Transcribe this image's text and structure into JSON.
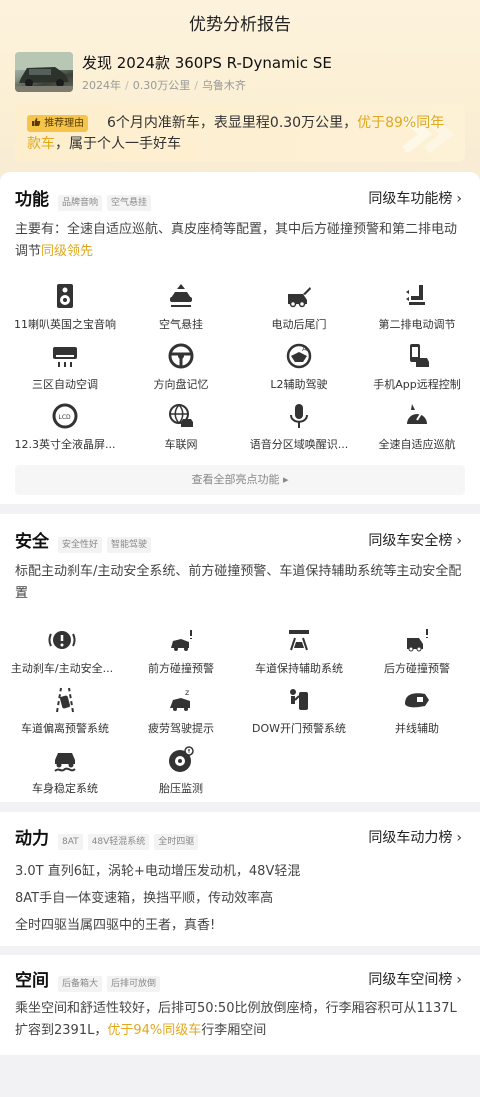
{
  "header": {
    "title": "优势分析报告"
  },
  "car": {
    "title": "发现 2024款 360PS R-Dynamic SE",
    "year": "2024年",
    "mileage": "0.30万公里",
    "city": "乌鲁木齐",
    "separator": "/"
  },
  "reason": {
    "tag": "推荐理由",
    "text_before": "6个月内准新车，表显里程0.30万公里，",
    "text_highlight": "优于89%同年款车",
    "text_after": "，属于个人一手好车"
  },
  "function": {
    "title": "功能",
    "chips": [
      "品牌音响",
      "空气悬挂"
    ],
    "rank_label": "同级车功能榜",
    "desc_before": "主要有：全速自适应巡航、真皮座椅等配置，其中后方碰撞预警和第二排电动调节",
    "desc_highlight": "同级领先",
    "items": [
      {
        "label": "11喇叭英国之宝音响",
        "icon": "speaker-icon"
      },
      {
        "label": "空气悬挂",
        "icon": "air-suspension-icon"
      },
      {
        "label": "电动后尾门",
        "icon": "power-tailgate-icon"
      },
      {
        "label": "第二排电动调节",
        "icon": "seat-adjust-icon"
      },
      {
        "label": "三区自动空调",
        "icon": "air-conditioner-icon"
      },
      {
        "label": "方向盘记忆",
        "icon": "steering-wheel-icon"
      },
      {
        "label": "L2辅助驾驶",
        "icon": "assisted-driving-icon"
      },
      {
        "label": "手机App远程控制",
        "icon": "phone-car-icon"
      },
      {
        "label": "12.3英寸全液晶屏...",
        "icon": "lcd-gauge-icon"
      },
      {
        "label": "车联网",
        "icon": "connected-car-icon"
      },
      {
        "label": "语音分区域唤醒识...",
        "icon": "microphone-icon"
      },
      {
        "label": "全速自适应巡航",
        "icon": "adaptive-cruise-icon"
      }
    ],
    "see_all": "查看全部亮点功能"
  },
  "safety": {
    "title": "安全",
    "chips": [
      "安全性好",
      "智能驾驶"
    ],
    "rank_label": "同级车安全榜",
    "desc": "标配主动刹车/主动安全系统、前方碰撞预警、车道保持辅助系统等主动安全配置",
    "items": [
      {
        "label": "主动刹车/主动安全...",
        "icon": "active-brake-icon"
      },
      {
        "label": "前方碰撞预警",
        "icon": "front-collision-icon"
      },
      {
        "label": "车道保持辅助系统",
        "icon": "lane-keep-icon"
      },
      {
        "label": "后方碰撞预警",
        "icon": "rear-collision-icon"
      },
      {
        "label": "车道偏离预警系统",
        "icon": "lane-departure-icon"
      },
      {
        "label": "疲劳驾驶提示",
        "icon": "fatigue-icon"
      },
      {
        "label": "DOW开门预警系统",
        "icon": "door-open-warning-icon"
      },
      {
        "label": "并线辅助",
        "icon": "blind-spot-icon"
      },
      {
        "label": "车身稳定系统",
        "icon": "stability-icon"
      },
      {
        "label": "胎压监测",
        "icon": "tire-pressure-icon"
      }
    ]
  },
  "power": {
    "title": "动力",
    "chips": [
      "8AT",
      "48V轻混系统",
      "全时四驱"
    ],
    "rank_label": "同级车动力榜",
    "lines": [
      "3.0T 直列6缸，涡轮+电动增压发动机，48V轻混",
      "8AT手自一体变速箱，换挡平顺，传动效率高",
      "全时四驱当属四驱中的王者，真香!"
    ]
  },
  "space": {
    "title": "空间",
    "chips": [
      "后备箱大",
      "后排可放倒"
    ],
    "rank_label": "同级车空间榜",
    "desc_before": "乘坐空间和舒适性较好，后排可50:50比例放倒座椅，行李厢容积可从1137L扩容到2391L，",
    "desc_highlight": "优于94%同级车",
    "desc_after": "行李厢空间"
  },
  "colors": {
    "accent": "#e0a81e",
    "tag_bg": "#f5c54b",
    "hero_bg": "#fdf3dd"
  }
}
